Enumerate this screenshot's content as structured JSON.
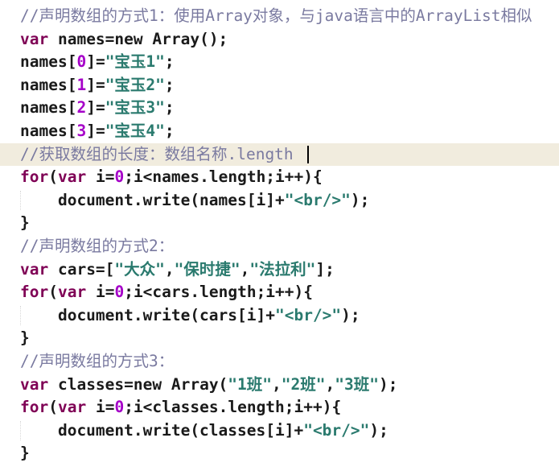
{
  "lines": [
    {
      "tokens": [
        {
          "t": "cm",
          "v": "//声明数组的方式1：使用Array对象，与java语言中的ArrayList相似"
        }
      ]
    },
    {
      "tokens": [
        {
          "t": "kw",
          "v": "var"
        },
        {
          "t": "pl",
          "v": " names=new Array();"
        }
      ]
    },
    {
      "tokens": [
        {
          "t": "pl",
          "v": "names["
        },
        {
          "t": "num",
          "v": "0"
        },
        {
          "t": "pl",
          "v": "]="
        },
        {
          "t": "str",
          "v": "\"宝玉1\""
        },
        {
          "t": "pl",
          "v": ";"
        }
      ]
    },
    {
      "tokens": [
        {
          "t": "pl",
          "v": "names["
        },
        {
          "t": "num",
          "v": "1"
        },
        {
          "t": "pl",
          "v": "]="
        },
        {
          "t": "str",
          "v": "\"宝玉2\""
        },
        {
          "t": "pl",
          "v": ";"
        }
      ]
    },
    {
      "tokens": [
        {
          "t": "pl",
          "v": "names["
        },
        {
          "t": "num",
          "v": "2"
        },
        {
          "t": "pl",
          "v": "]="
        },
        {
          "t": "str",
          "v": "\"宝玉3\""
        },
        {
          "t": "pl",
          "v": ";"
        }
      ]
    },
    {
      "tokens": [
        {
          "t": "pl",
          "v": "names["
        },
        {
          "t": "num",
          "v": "3"
        },
        {
          "t": "pl",
          "v": "]="
        },
        {
          "t": "str",
          "v": "\"宝玉4\""
        },
        {
          "t": "pl",
          "v": ";"
        }
      ]
    },
    {
      "current": true,
      "caret": true,
      "tokens": [
        {
          "t": "cm",
          "v": "//获取数组的长度：数组名称.length "
        }
      ]
    },
    {
      "tokens": [
        {
          "t": "kw",
          "v": "for"
        },
        {
          "t": "pl",
          "v": "("
        },
        {
          "t": "kw",
          "v": "var"
        },
        {
          "t": "pl",
          "v": " i="
        },
        {
          "t": "num",
          "v": "0"
        },
        {
          "t": "pl",
          "v": ";i<names.length;i++){"
        }
      ]
    },
    {
      "guide": true,
      "tokens": [
        {
          "t": "pl",
          "v": "    document.write(names[i]+"
        },
        {
          "t": "str",
          "v": "\"<br/>\""
        },
        {
          "t": "pl",
          "v": ");"
        }
      ]
    },
    {
      "tokens": [
        {
          "t": "pl",
          "v": "}"
        }
      ]
    },
    {
      "tokens": [
        {
          "t": "cm",
          "v": "//声明数组的方式2："
        }
      ]
    },
    {
      "tokens": [
        {
          "t": "kw",
          "v": "var"
        },
        {
          "t": "pl",
          "v": " cars=["
        },
        {
          "t": "str",
          "v": "\"大众\""
        },
        {
          "t": "pl",
          "v": ","
        },
        {
          "t": "str",
          "v": "\"保时捷\""
        },
        {
          "t": "pl",
          "v": ","
        },
        {
          "t": "str",
          "v": "\"法拉利\""
        },
        {
          "t": "pl",
          "v": "];"
        }
      ]
    },
    {
      "tokens": [
        {
          "t": "kw",
          "v": "for"
        },
        {
          "t": "pl",
          "v": "("
        },
        {
          "t": "kw",
          "v": "var"
        },
        {
          "t": "pl",
          "v": " i="
        },
        {
          "t": "num",
          "v": "0"
        },
        {
          "t": "pl",
          "v": ";i<cars.length;i++){"
        }
      ]
    },
    {
      "guide": true,
      "tokens": [
        {
          "t": "pl",
          "v": "    document.write(cars[i]+"
        },
        {
          "t": "str",
          "v": "\"<br/>\""
        },
        {
          "t": "pl",
          "v": ");"
        }
      ]
    },
    {
      "tokens": [
        {
          "t": "pl",
          "v": "}"
        }
      ]
    },
    {
      "tokens": [
        {
          "t": "cm",
          "v": "//声明数组的方式3："
        }
      ]
    },
    {
      "tokens": [
        {
          "t": "kw",
          "v": "var"
        },
        {
          "t": "pl",
          "v": " classes=new Array("
        },
        {
          "t": "str",
          "v": "\"1班\""
        },
        {
          "t": "pl",
          "v": ","
        },
        {
          "t": "str",
          "v": "\"2班\""
        },
        {
          "t": "pl",
          "v": ","
        },
        {
          "t": "str",
          "v": "\"3班\""
        },
        {
          "t": "pl",
          "v": ");"
        }
      ]
    },
    {
      "tokens": [
        {
          "t": "kw",
          "v": "for"
        },
        {
          "t": "pl",
          "v": "("
        },
        {
          "t": "kw",
          "v": "var"
        },
        {
          "t": "pl",
          "v": " i="
        },
        {
          "t": "num",
          "v": "0"
        },
        {
          "t": "pl",
          "v": ";i<classes.length;i++){"
        }
      ]
    },
    {
      "guide": true,
      "tokens": [
        {
          "t": "pl",
          "v": "    document.write(classes[i]+"
        },
        {
          "t": "str",
          "v": "\"<br/>\""
        },
        {
          "t": "pl",
          "v": ");"
        }
      ]
    },
    {
      "tokens": [
        {
          "t": "pl",
          "v": "}"
        }
      ]
    }
  ]
}
